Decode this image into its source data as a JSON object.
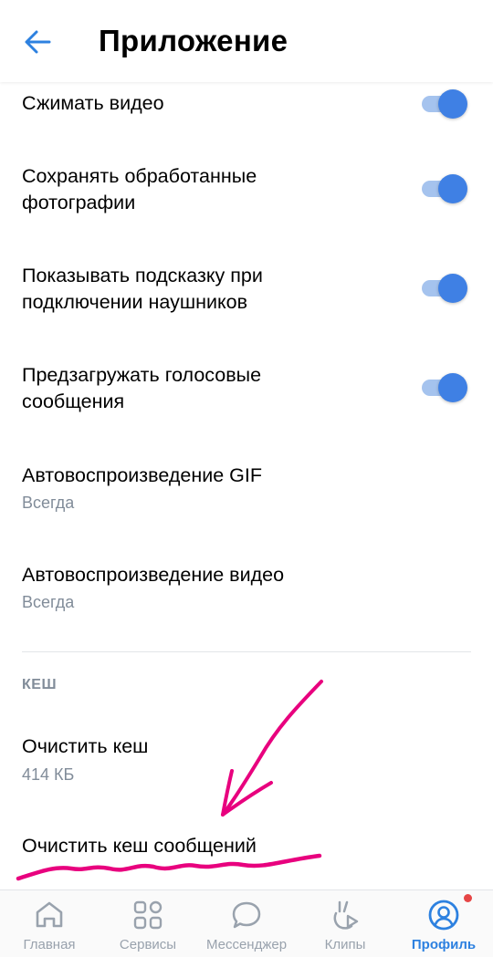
{
  "header": {
    "title": "Приложение",
    "back_icon": "arrow-left-icon"
  },
  "settings": [
    {
      "label": "Сжимать видео",
      "toggle": true
    },
    {
      "label_line1": "Сохранять обработанные",
      "label_line2": "фотографии",
      "toggle": true
    },
    {
      "label_line1": "Показывать подсказку при",
      "label_line2": "подключении наушников",
      "toggle": true
    },
    {
      "label_line1": "Предзагружать голосовые",
      "label_line2": "сообщения",
      "toggle": true
    },
    {
      "label": "Автовоспроизведение GIF",
      "value": "Всегда"
    },
    {
      "label": "Автовоспроизведение видео",
      "value": "Всегда"
    }
  ],
  "cache": {
    "section_title": "КЕШ",
    "clear_cache": {
      "label": "Очистить кеш",
      "size": "414 КБ"
    },
    "clear_messages_cache": {
      "label": "Очистить кеш сообщений"
    }
  },
  "tabbar": {
    "tabs": [
      {
        "label": "Главная",
        "icon": "home-icon"
      },
      {
        "label": "Сервисы",
        "icon": "services-icon"
      },
      {
        "label": "Мессенджер",
        "icon": "messenger-icon"
      },
      {
        "label": "Клипы",
        "icon": "clips-icon"
      },
      {
        "label": "Профиль",
        "icon": "profile-icon",
        "active": true,
        "badge": true
      }
    ]
  },
  "colors": {
    "accent": "#3f80e4",
    "toggle_track": "#a5c3ee",
    "secondary_text": "#818c99",
    "annotation": "#e8007e",
    "badge": "#e64646"
  }
}
